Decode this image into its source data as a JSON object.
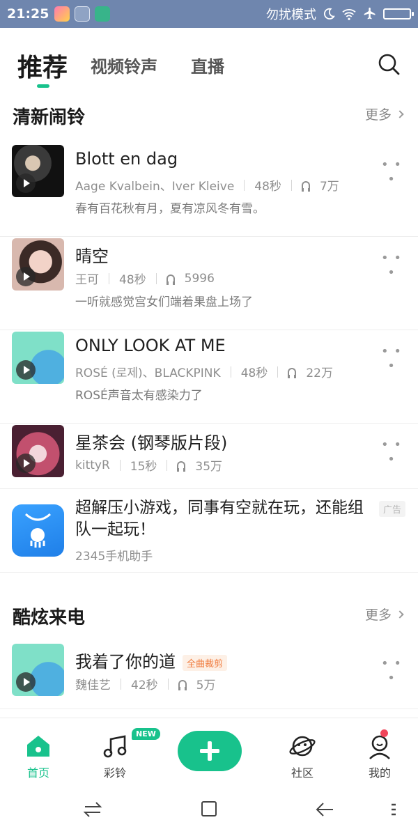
{
  "status_bar": {
    "time": "21:25",
    "mode": "勿扰模式"
  },
  "tabs": [
    {
      "label": "推荐"
    },
    {
      "label": "视频铃声"
    },
    {
      "label": "直播"
    }
  ],
  "sections": [
    {
      "title": "清新闹铃",
      "more": "更多",
      "items": [
        {
          "title": "Blott en dag",
          "artist": "Aage Kvalbein、Iver Kleive",
          "duration": "48秒",
          "plays": "7万",
          "desc": "春有百花秋有月，夏有凉风冬有雪。"
        },
        {
          "title": "晴空",
          "artist": "王可",
          "duration": "48秒",
          "plays": "5996",
          "desc": "一听就感觉宫女们端着果盘上场了"
        },
        {
          "title": "ONLY LOOK AT ME",
          "artist": "ROSÉ (로제)、BLACKPINK",
          "duration": "48秒",
          "plays": "22万",
          "desc": "ROSÉ声音太有感染力了"
        },
        {
          "title": "星茶会 (钢琴版片段)",
          "artist": "kittyR",
          "duration": "15秒",
          "plays": "35万",
          "desc": ""
        }
      ]
    },
    {
      "title": "酷炫来电",
      "more": "更多",
      "items": [
        {
          "title": "我着了你的道",
          "tag": "全曲裁剪",
          "artist": "魏佳艺",
          "duration": "42秒",
          "plays": "5万"
        }
      ]
    }
  ],
  "ad": {
    "title": "超解压小游戏，同事有空就在玩，还能组队一起玩！",
    "source": "2345手机助手",
    "badge": "广告"
  },
  "bottom_nav": {
    "home": "首页",
    "ringtone": "彩铃",
    "new_badge": "NEW",
    "community": "社区",
    "mine": "我的"
  },
  "colors": {
    "accent": "#18c28c",
    "status_bar": "#6f86ae",
    "notification_dot": "#f0455a"
  }
}
